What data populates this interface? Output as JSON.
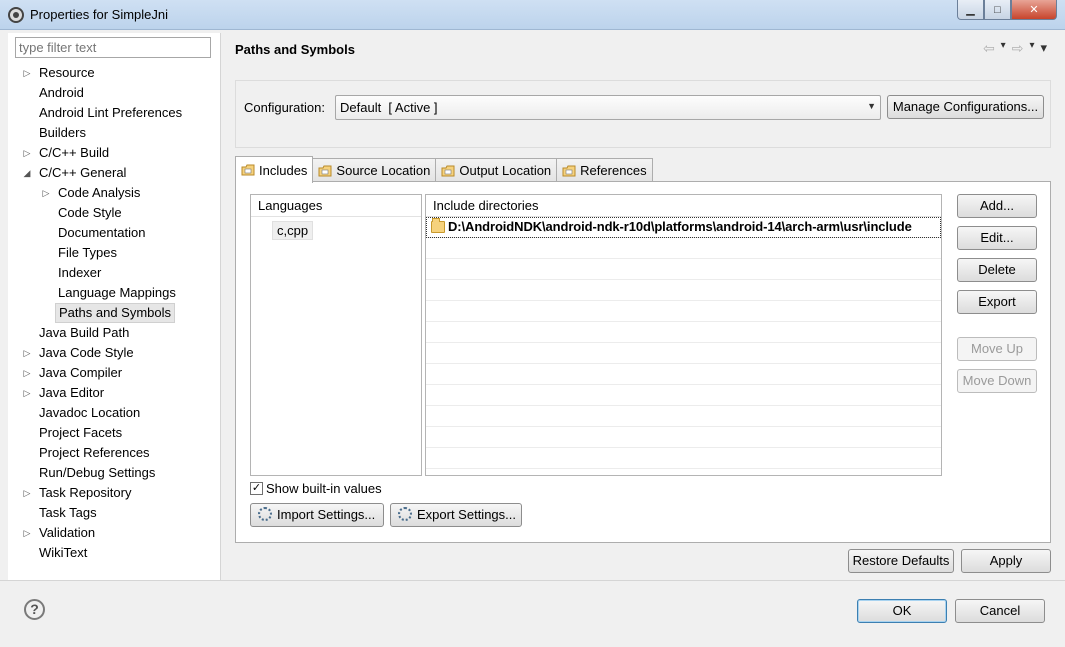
{
  "window": {
    "title": "Properties for SimpleJni",
    "min_label": "▁",
    "max_label": "□",
    "close_label": "✕"
  },
  "filter": {
    "placeholder": "type filter text"
  },
  "tree": [
    {
      "label": "Resource",
      "level": 0,
      "arrow": "▷"
    },
    {
      "label": "Android",
      "level": 0,
      "arrow": ""
    },
    {
      "label": "Android Lint Preferences",
      "level": 0,
      "arrow": ""
    },
    {
      "label": "Builders",
      "level": 0,
      "arrow": ""
    },
    {
      "label": "C/C++ Build",
      "level": 0,
      "arrow": "▷"
    },
    {
      "label": "C/C++ General",
      "level": 0,
      "arrow": "◢"
    },
    {
      "label": "Code Analysis",
      "level": 1,
      "arrow": "▷"
    },
    {
      "label": "Code Style",
      "level": 1,
      "arrow": ""
    },
    {
      "label": "Documentation",
      "level": 1,
      "arrow": ""
    },
    {
      "label": "File Types",
      "level": 1,
      "arrow": ""
    },
    {
      "label": "Indexer",
      "level": 1,
      "arrow": ""
    },
    {
      "label": "Language Mappings",
      "level": 1,
      "arrow": ""
    },
    {
      "label": "Paths and Symbols",
      "level": 1,
      "arrow": "",
      "selected": true
    },
    {
      "label": "Java Build Path",
      "level": 0,
      "arrow": ""
    },
    {
      "label": "Java Code Style",
      "level": 0,
      "arrow": "▷"
    },
    {
      "label": "Java Compiler",
      "level": 0,
      "arrow": "▷"
    },
    {
      "label": "Java Editor",
      "level": 0,
      "arrow": "▷"
    },
    {
      "label": "Javadoc Location",
      "level": 0,
      "arrow": ""
    },
    {
      "label": "Project Facets",
      "level": 0,
      "arrow": ""
    },
    {
      "label": "Project References",
      "level": 0,
      "arrow": ""
    },
    {
      "label": "Run/Debug Settings",
      "level": 0,
      "arrow": ""
    },
    {
      "label": "Task Repository",
      "level": 0,
      "arrow": "▷"
    },
    {
      "label": "Task Tags",
      "level": 0,
      "arrow": ""
    },
    {
      "label": "Validation",
      "level": 0,
      "arrow": "▷"
    },
    {
      "label": "WikiText",
      "level": 0,
      "arrow": ""
    }
  ],
  "page": {
    "title": "Paths and Symbols",
    "back_icon": "⇦",
    "forward_icon": "⇨",
    "menu_icon": "▾"
  },
  "configuration": {
    "label": "Configuration:",
    "value": "Default  [ Active ]",
    "manage_button": "Manage Configurations..."
  },
  "tabs": [
    {
      "label": "Includes",
      "icon": "include-folder-icon",
      "active": true
    },
    {
      "label": "Source Location",
      "icon": "source-folder-icon",
      "active": false
    },
    {
      "label": "Output Location",
      "icon": "output-folder-icon",
      "active": false
    },
    {
      "label": "References",
      "icon": "references-icon",
      "active": false
    }
  ],
  "languages": {
    "header": "Languages",
    "items": [
      "c,cpp"
    ]
  },
  "include_dirs": {
    "header": "Include directories",
    "items": [
      "D:\\AndroidNDK\\android-ndk-r10d\\platforms\\android-14\\arch-arm\\usr\\include"
    ]
  },
  "side_buttons": {
    "add": "Add...",
    "edit": "Edit...",
    "delete": "Delete",
    "export": "Export",
    "move_up": "Move Up",
    "move_down": "Move Down"
  },
  "show_builtin": {
    "label": "Show built-in values",
    "checked": true,
    "mark": "✓"
  },
  "import_settings": "Import Settings...",
  "export_settings": "Export Settings...",
  "restore_defaults": "Restore Defaults",
  "apply": "Apply",
  "ok": "OK",
  "cancel": "Cancel",
  "help_glyph": "?"
}
